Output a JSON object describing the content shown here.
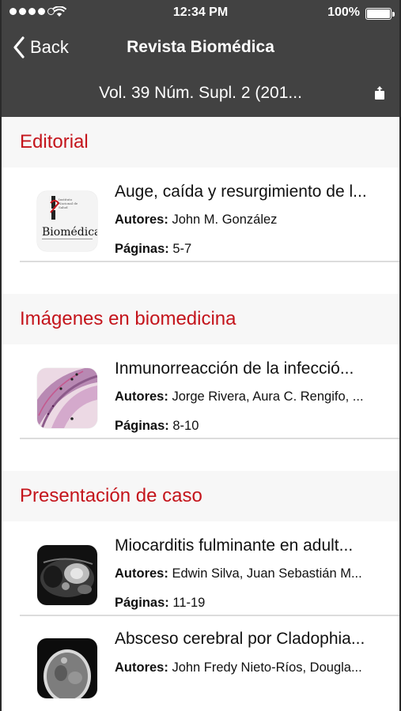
{
  "status": {
    "time": "12:34 PM",
    "battery": "100%"
  },
  "nav": {
    "back_label": "Back",
    "title": "Revista Biomédica"
  },
  "issue": {
    "title": "Vol. 39 Núm. Supl. 2 (201..."
  },
  "labels": {
    "authors": "Autores:",
    "pages": "Páginas:"
  },
  "sections": [
    {
      "title": "Editorial",
      "articles": [
        {
          "title": "Auge, caída y resurgimiento de l...",
          "authors": "John M. González",
          "pages": "5-7"
        }
      ]
    },
    {
      "title": "Imágenes en biomedicina",
      "articles": [
        {
          "title": "Inmunorreacción de la infecció...",
          "authors": "Jorge Rivera, Aura C. Rengifo, ...",
          "pages": "8-10"
        }
      ]
    },
    {
      "title": "Presentación de caso",
      "articles": [
        {
          "title": "Miocarditis fulminante en adult...",
          "authors": "Edwin Silva, Juan Sebastián M...",
          "pages": "11-19"
        },
        {
          "title": "Absceso cerebral por Cladophia...",
          "authors": "John Fredy Nieto-Ríos, Dougla...",
          "pages": ""
        }
      ]
    }
  ],
  "cover_logo": {
    "brand": "Biomédica",
    "header_lines": [
      "Instituto",
      "Nacional de",
      "Salud"
    ]
  }
}
